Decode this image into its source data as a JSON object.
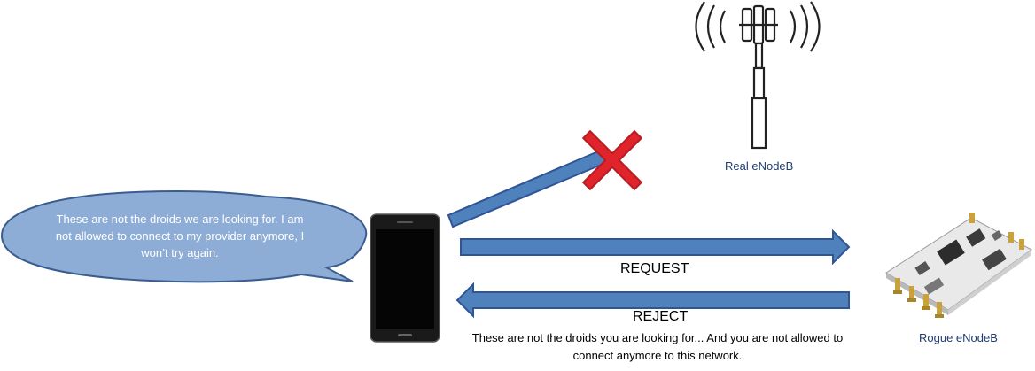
{
  "speech_bubble": {
    "text": "These are not the droids we are looking for. I am not allowed to connect to my provider anymore, I won’t try again."
  },
  "arrows": {
    "request_label": "REQUEST",
    "reject_label": "REJECT",
    "reject_message": "These are not the droids you are looking for...  And you are not allowed to connect anymore to this network."
  },
  "nodes": {
    "real_enodeb": "Real eNodeB",
    "rogue_enodeb": "Rogue eNodeB"
  },
  "colors": {
    "arrow_fill": "#4f81bd",
    "arrow_stroke": "#2f5597",
    "bubble_fill": "#8eadd6",
    "bubble_stroke": "#3a5d8f",
    "cross": "#e0242b",
    "label_blue": "#1f3c73"
  }
}
